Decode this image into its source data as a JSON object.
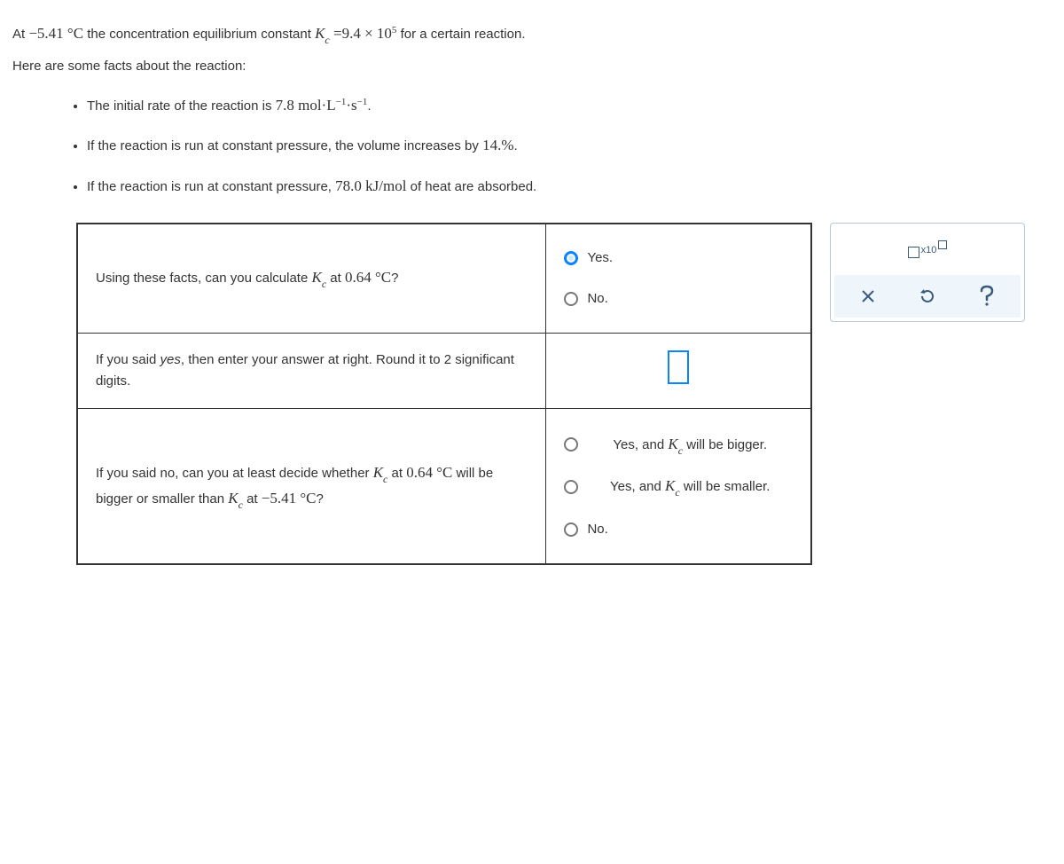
{
  "intro": {
    "line1_pre": "At ",
    "temp1": "−5.41 °C",
    "line1_mid": " the concentration equilibrium constant ",
    "kc": "K",
    "kc_sub": "c",
    "eq": " =",
    "kval": "9.4 × 10",
    "kexp": "5",
    "line1_post": " for a certain reaction.",
    "line2": "Here are some facts about the reaction:"
  },
  "facts": [
    {
      "pre": "The initial rate of the reaction is ",
      "num": "7.8 mol·L",
      "exp1": "−1",
      "mid": "·s",
      "exp2": "−1",
      "post": "."
    },
    {
      "pre": "If the reaction is run at constant pressure, the volume increases by ",
      "num": "14.%",
      "post": "."
    },
    {
      "pre": "If the reaction is run at constant pressure, ",
      "num": "78.0  kJ/mol",
      "post": " of heat are absorbed."
    }
  ],
  "rows": {
    "r1": {
      "q_pre": "Using these facts, can you calculate ",
      "q_mid": " at ",
      "q_temp": "0.64 °C",
      "q_post": "?",
      "yes": "Yes.",
      "no": "No."
    },
    "r2": {
      "q_pre": "If you said ",
      "q_yes": "yes",
      "q_post": ", then enter your answer at right. Round it to 2 significant digits."
    },
    "r3": {
      "q_pre": "If you said no, can you at least decide whether ",
      "q_mid1": " at ",
      "q_t1": "0.64 °C",
      "q_mid2": " will be bigger or smaller than ",
      "q_mid3": " at ",
      "q_t2": "−5.41 °C",
      "q_post": "?",
      "opt1_pre": "Yes, and ",
      "opt1_post": " will be bigger.",
      "opt2_pre": "Yes, and ",
      "opt2_post": " will be smaller.",
      "no": "No."
    }
  },
  "palette": {
    "x10": "x10"
  }
}
